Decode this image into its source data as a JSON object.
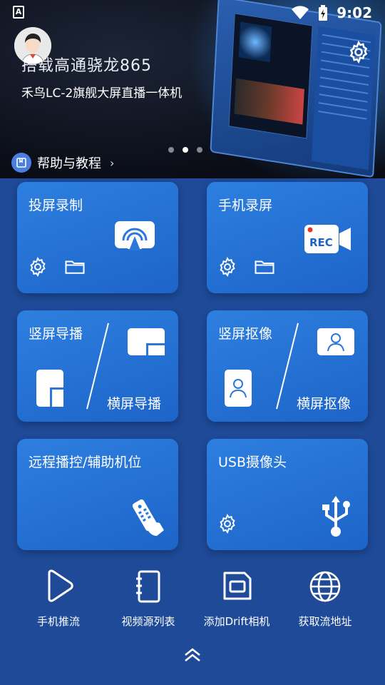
{
  "status_bar": {
    "time": "9:02",
    "app_indicator": "A"
  },
  "banner": {
    "title": "搭载高通骁龙865",
    "subtitle": "禾鸟LC-2旗舰大屏直播一体机",
    "slide_count": 3,
    "active_slide": 2
  },
  "help": {
    "label": "帮助与教程",
    "chevron": "›"
  },
  "cards": {
    "screen_cast": {
      "title": "投屏录制"
    },
    "phone_record": {
      "title": "手机录屏",
      "badge": "REC"
    },
    "portrait_director": {
      "title": "竖屏导播",
      "sub": "横屏导播"
    },
    "portrait_camera": {
      "title": "竖屏抠像",
      "sub": "横屏抠像"
    },
    "remote_control": {
      "title": "远程播控/辅助机位"
    },
    "usb_camera": {
      "title": "USB摄像头"
    }
  },
  "bottom_nav": [
    {
      "label": "手机推流",
      "icon": "play-icon"
    },
    {
      "label": "视频源列表",
      "icon": "notebook-icon"
    },
    {
      "label": "添加Drift相机",
      "icon": "camera-box-icon"
    },
    {
      "label": "获取流地址",
      "icon": "globe-icon"
    }
  ],
  "colors": {
    "background": "#1e4a98",
    "card": "#2a78dc",
    "accent_red": "#e8322a"
  }
}
